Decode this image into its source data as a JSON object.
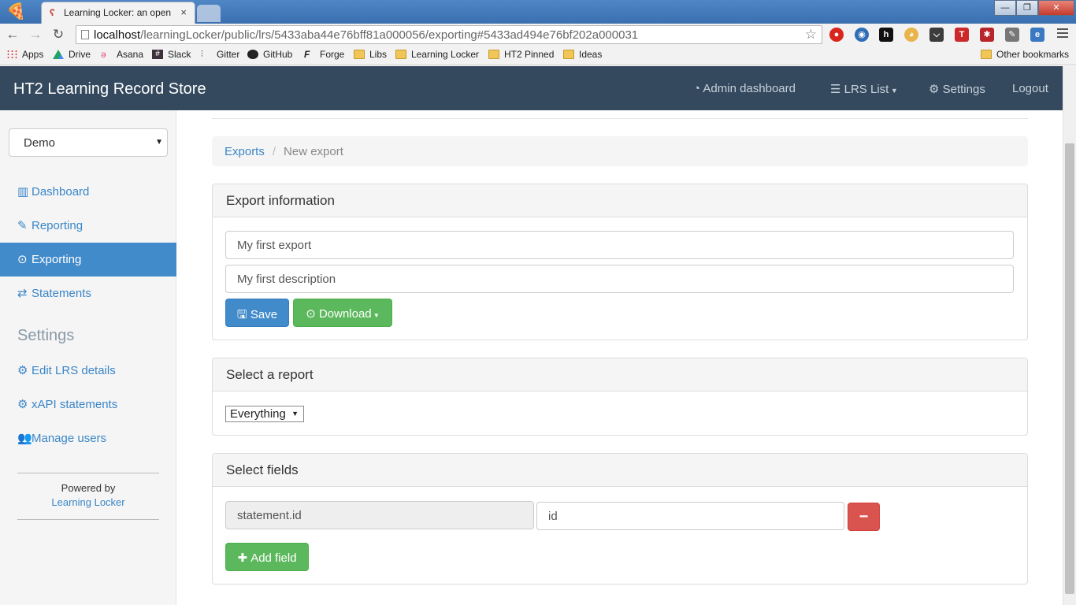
{
  "browser": {
    "tab_title": "Learning Locker: an open",
    "tab_close": "×",
    "url_host": "localhost",
    "url_path": "/learningLocker/public/lrs/5433aba44e76bff81a000056/exporting#5433ad494e76bf202a000031",
    "window_controls": {
      "minimize": "—",
      "maximize": "❐",
      "close": "✕"
    },
    "bookmarks": [
      {
        "label": "Apps",
        "icon": "apps-icon"
      },
      {
        "label": "Drive",
        "icon": "drive-icon"
      },
      {
        "label": "Asana",
        "icon": "asana-icon"
      },
      {
        "label": "Slack",
        "icon": "slack-icon"
      },
      {
        "label": "Gitter",
        "icon": "gitter-icon"
      },
      {
        "label": "GitHub",
        "icon": "github-icon"
      },
      {
        "label": "Forge",
        "icon": "forge-icon"
      },
      {
        "label": "Libs",
        "icon": "folder-icon"
      },
      {
        "label": "Learning Locker",
        "icon": "folder-icon"
      },
      {
        "label": "HT2 Pinned",
        "icon": "folder-icon"
      },
      {
        "label": "Ideas",
        "icon": "folder-icon"
      }
    ],
    "other_bookmarks": "Other bookmarks"
  },
  "navbar": {
    "brand": "HT2 Learning Record Store",
    "admin_dashboard": "Admin dashboard",
    "lrs_list": "LRS List",
    "settings": "Settings",
    "logout": "Logout"
  },
  "sidebar": {
    "lrs_selected": "Demo",
    "items": [
      {
        "label": "Dashboard",
        "icon": "chart-icon"
      },
      {
        "label": "Reporting",
        "icon": "pencil-icon"
      },
      {
        "label": "Exporting",
        "icon": "download-circle-icon",
        "active": true
      },
      {
        "label": "Statements",
        "icon": "exchange-icon"
      }
    ],
    "settings_heading": "Settings",
    "settings_items": [
      {
        "label": "Edit LRS details",
        "icon": "gear-icon"
      },
      {
        "label": "xAPI statements",
        "icon": "gears-icon"
      },
      {
        "label": "Manage users",
        "icon": "users-icon"
      }
    ],
    "powered_by": "Powered by",
    "powered_link": "Learning Locker"
  },
  "breadcrumb": {
    "parent": "Exports",
    "separator": "/",
    "current": "New export"
  },
  "export_info": {
    "heading": "Export information",
    "name_value": "My first export",
    "description_value": "My first description",
    "save_label": "Save",
    "download_label": "Download"
  },
  "report": {
    "heading": "Select a report",
    "selected": "Everything"
  },
  "fields": {
    "heading": "Select fields",
    "rows": [
      {
        "from": "statement.id",
        "to": "id"
      }
    ],
    "remove_label": "−",
    "add_label": "Add field"
  },
  "colors": {
    "navbar": "#34495e",
    "primary": "#428bca",
    "success": "#5cb85c",
    "danger": "#d9534f",
    "link": "#3a86c8"
  }
}
